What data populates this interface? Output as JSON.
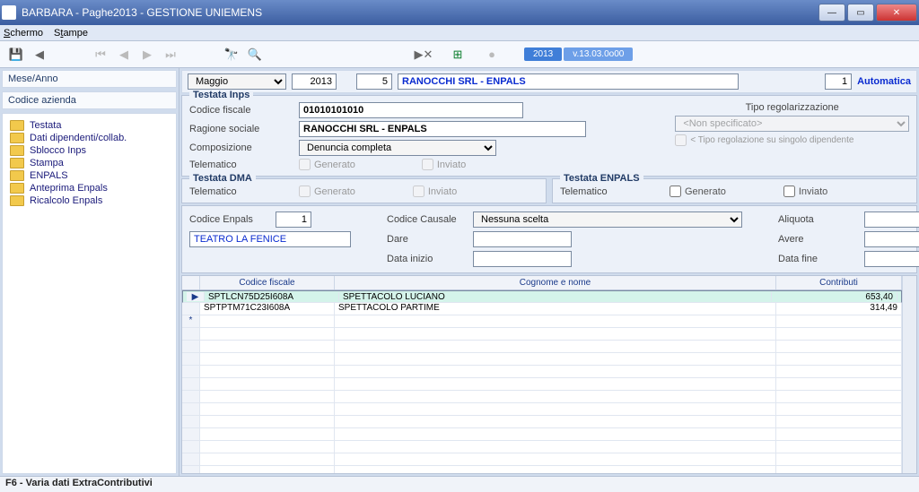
{
  "window": {
    "title": "BARBARA - Paghe2013 - GESTIONE UNIEMENS"
  },
  "menu": {
    "schermo": "Schermo",
    "stampe": "Stampe"
  },
  "toolbar": {
    "year_pill": "2013",
    "ver_pill": "v.13.03.0o00"
  },
  "side": {
    "mese_anno": "Mese/Anno",
    "codice_azienda": "Codice azienda",
    "tree": [
      "Testata",
      "Dati dipendenti/collab.",
      "Sblocco Inps",
      "Stampa",
      "ENPALS",
      "Anteprima Enpals",
      "Ricalcolo Enpals"
    ]
  },
  "filter": {
    "mese": "Maggio",
    "anno": "2013",
    "cod_az": "5",
    "az_name": "RANOCCHI SRL - ENPALS",
    "auto_num": "1",
    "auto_label": "Automatica"
  },
  "testata_inps": {
    "legend": "Testata Inps",
    "codice_fiscale_lbl": "Codice fiscale",
    "codice_fiscale": "01010101010",
    "ragione_sociale_lbl": "Ragione sociale",
    "ragione_sociale": "RANOCCHI SRL - ENPALS",
    "composizione_lbl": "Composizione",
    "composizione": "Denuncia completa",
    "telematico_lbl": "Telematico",
    "generato_lbl": "Generato",
    "inviato_lbl": "Inviato",
    "tipo_reg_lbl": "Tipo regolarizzazione",
    "tipo_reg": "<Non specificato>",
    "tipo_reg_note": "< Tipo regolazione su singolo dipendente"
  },
  "testata_dma": {
    "legend": "Testata DMA",
    "telematico_lbl": "Telematico",
    "generato_lbl": "Generato",
    "inviato_lbl": "Inviato"
  },
  "testata_enpals": {
    "legend": "Testata ENPALS",
    "telematico_lbl": "Telematico",
    "generato_lbl": "Generato",
    "inviato_lbl": "Inviato"
  },
  "details": {
    "codice_enpals_lbl": "Codice Enpals",
    "codice_enpals": "1",
    "teatro": "TEATRO LA FENICE",
    "codice_causale_lbl": "Codice Causale",
    "codice_causale": "Nessuna scelta",
    "dare_lbl": "Dare",
    "data_inizio_lbl": "Data inizio",
    "aliquota_lbl": "Aliquota",
    "avere_lbl": "Avere",
    "data_fine_lbl": "Data fine"
  },
  "grid": {
    "h1": "Codice fiscale",
    "h2": "Cognome e nome",
    "h3": "Contributi",
    "rows": [
      {
        "cf": "SPTLCN75D25I608A",
        "nome": "SPETTACOLO LUCIANO",
        "contr": "653,40"
      },
      {
        "cf": "SPTPTM71C23I608A",
        "nome": "SPETTACOLO PARTIME",
        "contr": "314,49"
      }
    ]
  },
  "status": "F6 - Varia dati ExtraContributivi"
}
